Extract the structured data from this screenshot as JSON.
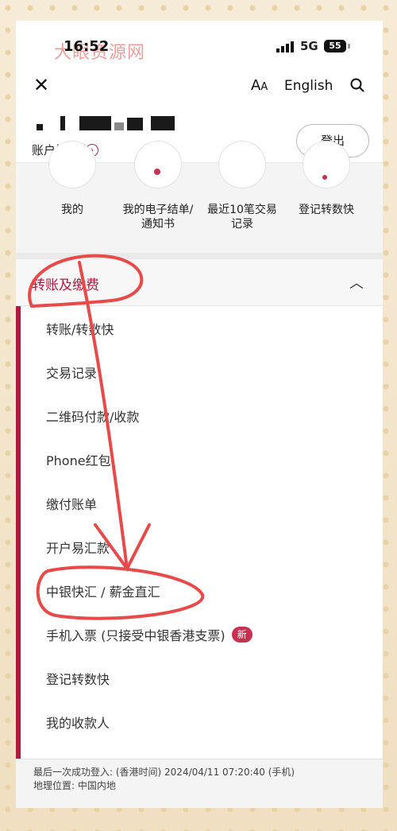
{
  "status_bar": {
    "time": "16:52",
    "network": "5G",
    "battery": "55",
    "watermark": "大眼资源网"
  },
  "header": {
    "font_size_label": "AA",
    "language": "English",
    "close_icon": "close-icon",
    "search_icon": "search-icon"
  },
  "account": {
    "overview_label": "账户概览",
    "logout_label": "登出"
  },
  "quick_actions": [
    {
      "label": "我的"
    },
    {
      "label": "我的电子结单/通知书"
    },
    {
      "label": "最近10笔交易记录"
    },
    {
      "label": "登记转数快"
    }
  ],
  "section": {
    "title": "转账及缴费",
    "items": [
      {
        "label": "转账/转数快"
      },
      {
        "label": "交易记录"
      },
      {
        "label": "二维码付款/收款"
      },
      {
        "label": "Phone红包"
      },
      {
        "label": "缴付账单"
      },
      {
        "label": "开户易汇款"
      },
      {
        "label": "中银快汇 / 薪金直汇"
      },
      {
        "label": "手机入票 (只接受中银香港支票)",
        "badge": "新"
      },
      {
        "label": "登记转数快"
      },
      {
        "label": "我的收款人"
      }
    ]
  },
  "footer": {
    "last_login": "最后一次成功登入: (香港时间) 2024/04/11 07:20:40 (手机)",
    "location": "地理位置: 中国内地"
  },
  "colors": {
    "accent": "#b2173f",
    "annotation": "#e84a4a"
  }
}
